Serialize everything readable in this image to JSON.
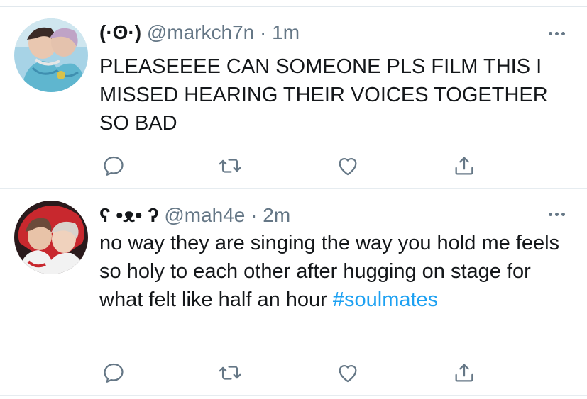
{
  "tweets": [
    {
      "display_name": "(·ʘ·)",
      "handle": "@markch7n",
      "separator": "·",
      "time": "1m",
      "text": "PLEASEEEE CAN SOMEONE PLS FILM THIS I MISSED HEARING THEIR VOICES TOGETHER SO BAD",
      "hashtag": "",
      "avatar_icon": "avatar-photo-icon"
    },
    {
      "display_name": "ʕ •ᴥ• ʔ",
      "handle": "@mah4e",
      "separator": "·",
      "time": "2m",
      "text": "no way they are singing the way you hold me feels so holy to each other after hugging on stage for what felt like half an hour ",
      "hashtag": "#soulmates",
      "avatar_icon": "avatar-photo-icon"
    }
  ],
  "actions": [
    "reply-icon",
    "retweet-icon",
    "like-icon",
    "share-icon"
  ],
  "colors": {
    "text": "#14171a",
    "muted": "#657786",
    "link": "#1da1f2",
    "divider": "#e6ecf0"
  }
}
